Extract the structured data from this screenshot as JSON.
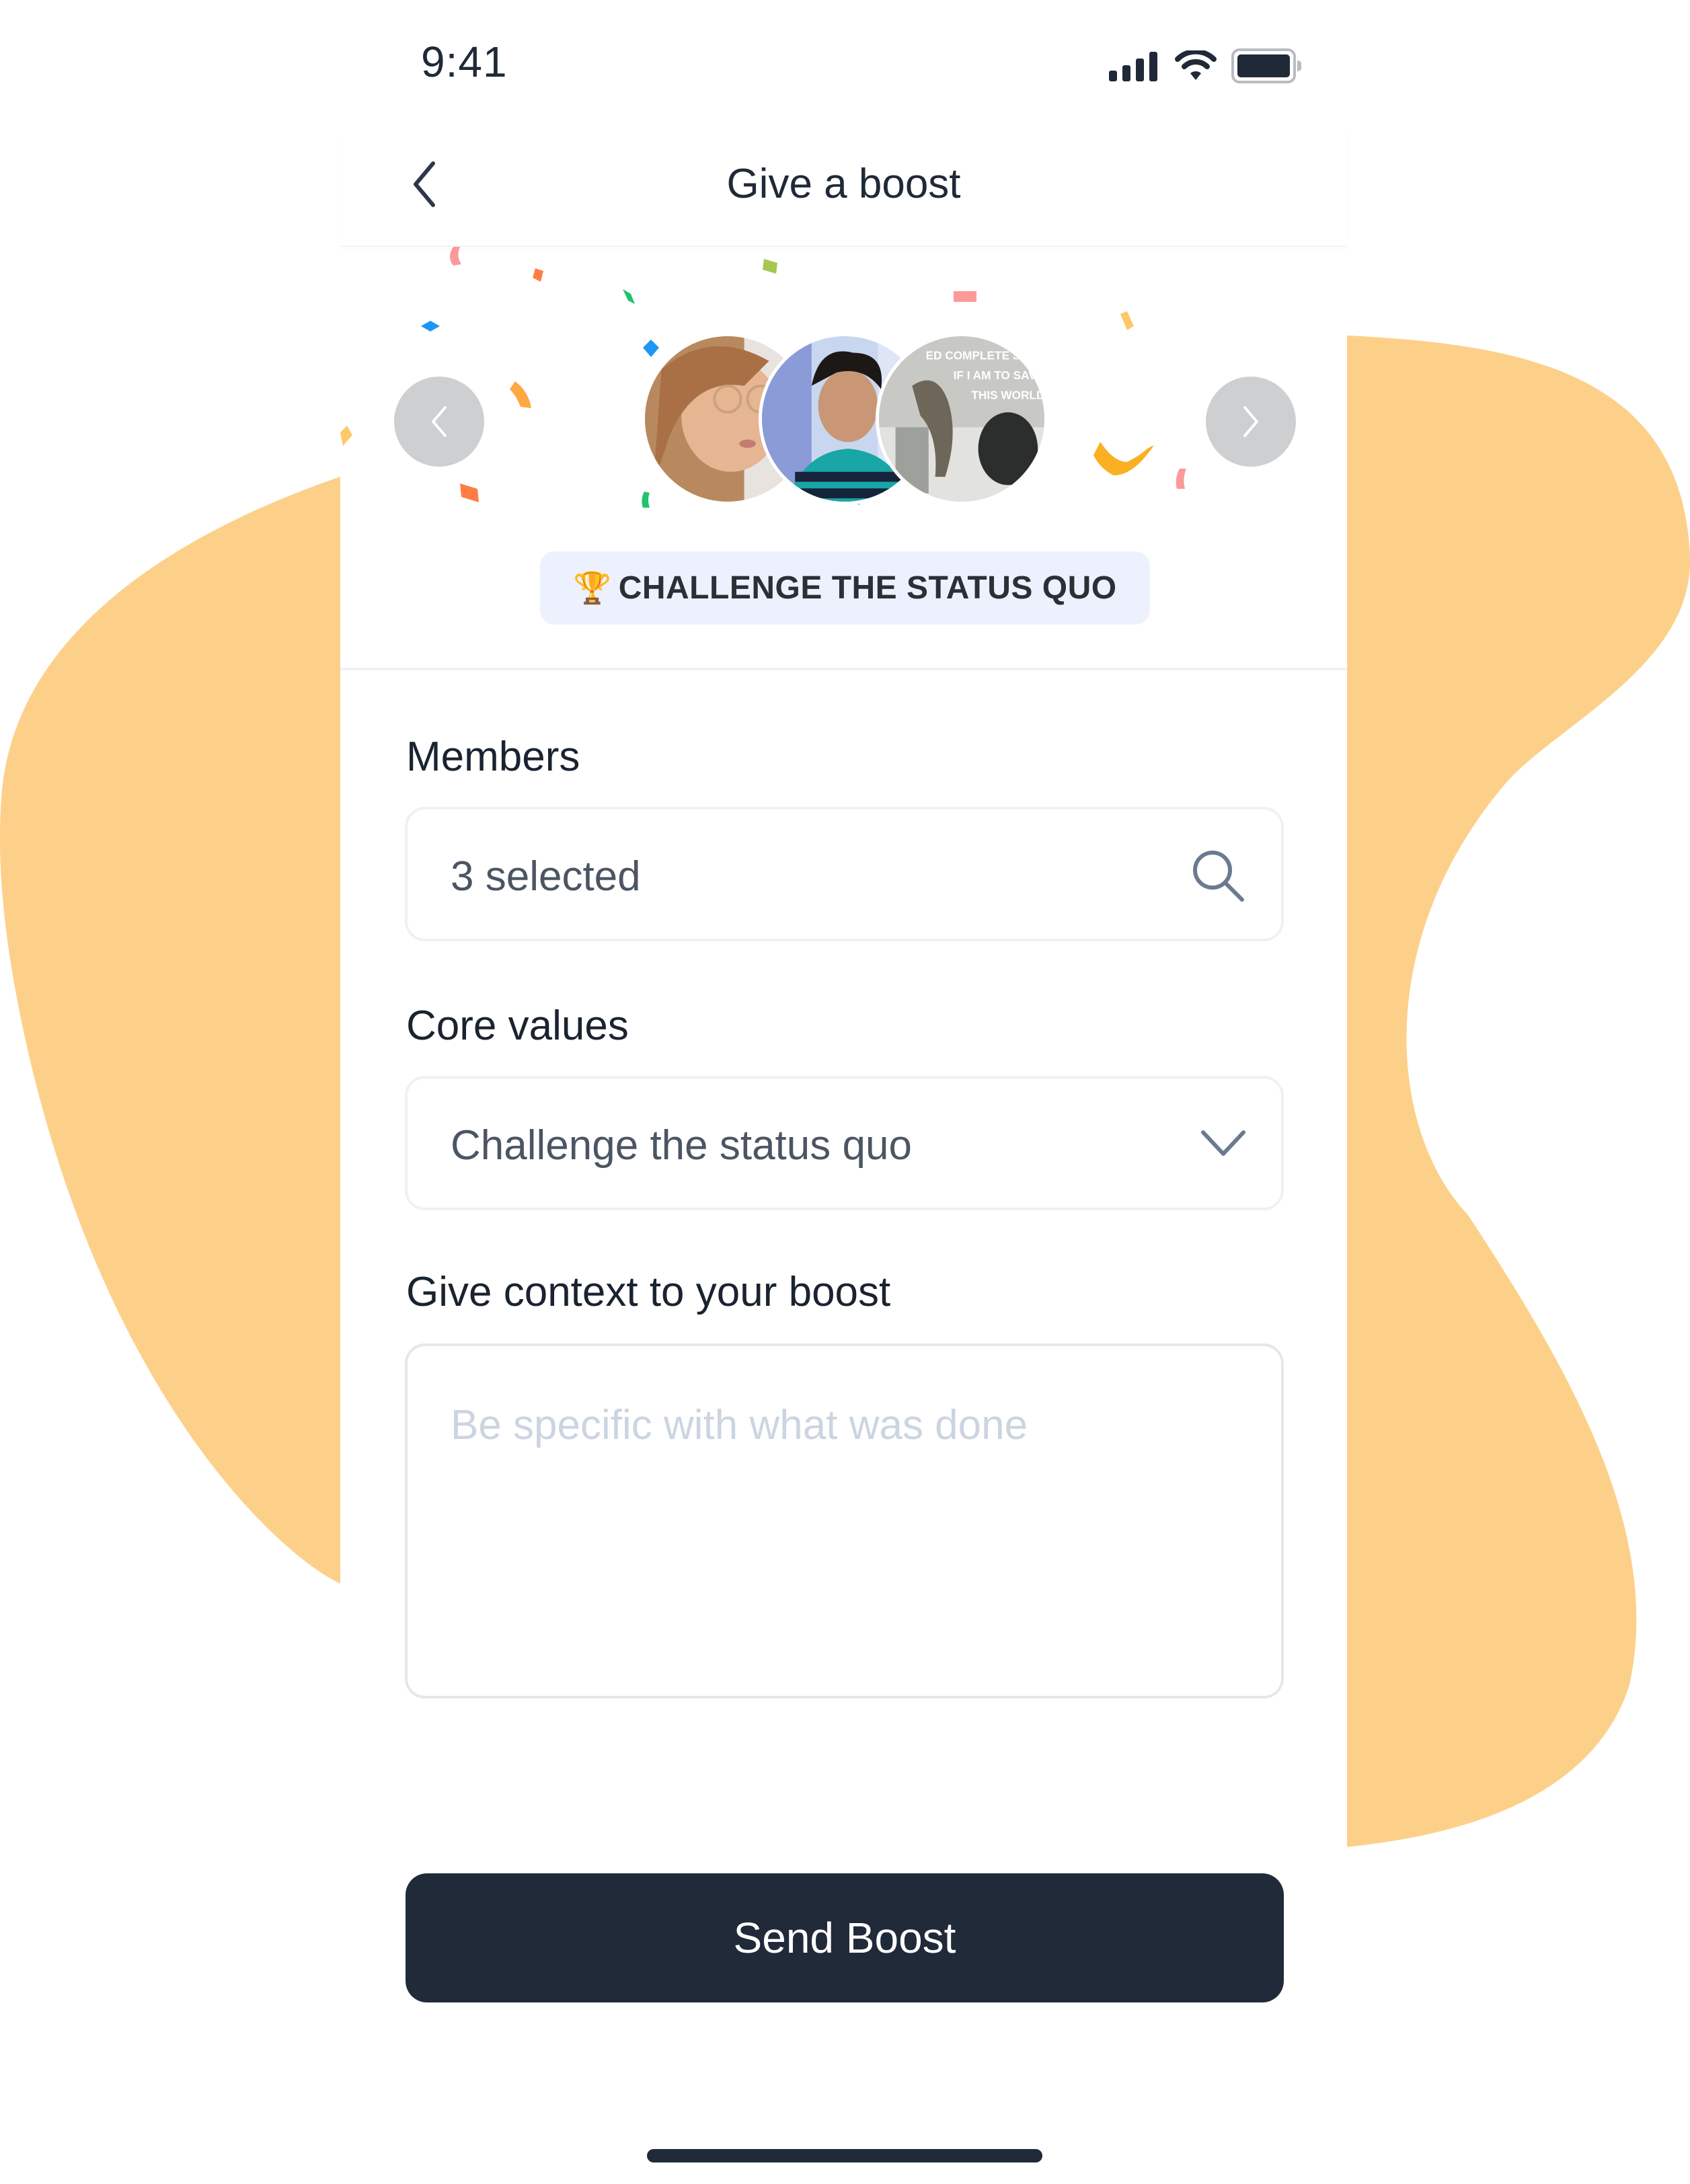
{
  "status_bar": {
    "time": "9:41",
    "icons": [
      "cellular-signal-icon",
      "wifi-icon",
      "battery-icon"
    ]
  },
  "nav": {
    "title": "Give a boost",
    "back_icon": "chevron-left-icon"
  },
  "hero": {
    "prev_icon": "chevron-left-icon",
    "next_icon": "chevron-right-icon",
    "avatars": [
      {
        "description": "woman with glasses"
      },
      {
        "description": "man in striped shirt"
      },
      {
        "description": "cat meme",
        "caption_lines": [
          "...ED COMPLETE SIL...",
          "IF I AM TO SAV...",
          "THIS WORLD"
        ]
      }
    ],
    "badge": {
      "icon": "🏆",
      "label": "CHALLENGE THE STATUS QUO"
    }
  },
  "form": {
    "members": {
      "label": "Members",
      "value": "3 selected",
      "icon": "search-icon"
    },
    "core_values": {
      "label": "Core values",
      "value": "Challenge the status quo",
      "icon": "chevron-down-icon"
    },
    "context": {
      "label": "Give context to your boost",
      "placeholder": "Be specific with what was done",
      "value": ""
    }
  },
  "actions": {
    "send_label": "Send Boost"
  },
  "colors": {
    "accent_blob": "#fdd08a",
    "primary_button": "#212a39",
    "badge_bg": "#edf1fd",
    "text_primary": "#1a2330",
    "placeholder": "#cbd5e1"
  }
}
